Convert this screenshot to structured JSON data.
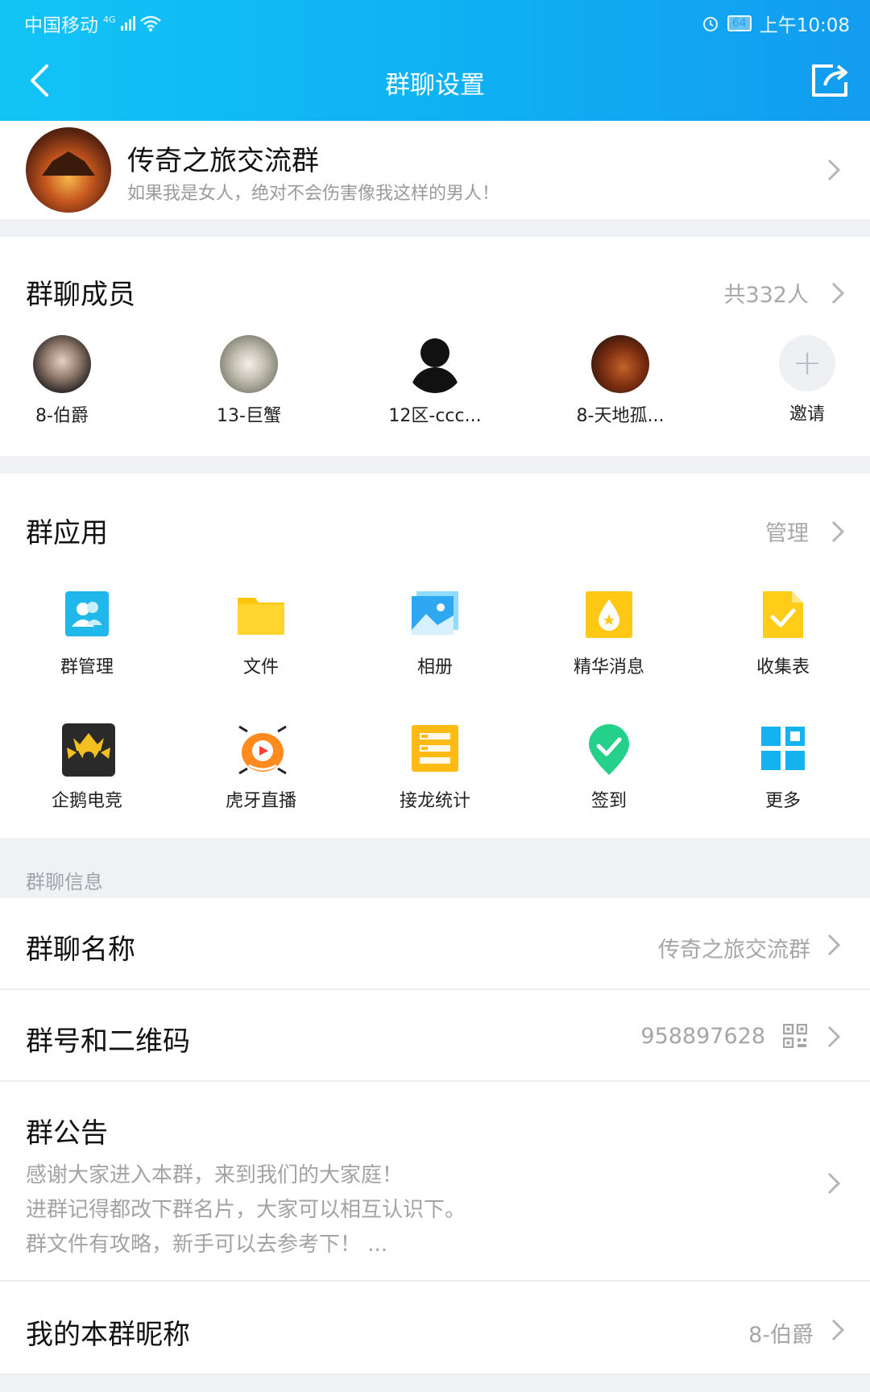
{
  "status_bar": {
    "carrier": "中国移动",
    "network": "4G",
    "battery": "64",
    "time": "上午10:08"
  },
  "nav": {
    "title": "群聊设置"
  },
  "group": {
    "name": "传奇之旅交流群",
    "description": "如果我是女人，绝对不会伤害像我这样的男人！"
  },
  "members": {
    "title": "群聊成员",
    "count": "共332人",
    "items": [
      {
        "name": "8-伯爵"
      },
      {
        "name": "13-巨蟹"
      },
      {
        "name": "12区-ccc..."
      },
      {
        "name": "8-天地孤..."
      }
    ],
    "invite_label": "邀请"
  },
  "apps": {
    "title": "群应用",
    "manage_label": "管理",
    "items": [
      {
        "label": "群管理",
        "icon": "group-manage-icon"
      },
      {
        "label": "文件",
        "icon": "folder-icon"
      },
      {
        "label": "相册",
        "icon": "album-icon"
      },
      {
        "label": "精华消息",
        "icon": "essence-icon"
      },
      {
        "label": "收集表",
        "icon": "form-icon"
      },
      {
        "label": "企鹅电竞",
        "icon": "penguin-esports-icon"
      },
      {
        "label": "虎牙直播",
        "icon": "huya-live-icon"
      },
      {
        "label": "接龙统计",
        "icon": "relay-stats-icon"
      },
      {
        "label": "签到",
        "icon": "checkin-icon"
      },
      {
        "label": "更多",
        "icon": "more-grid-icon"
      }
    ]
  },
  "info": {
    "section_title": "群聊信息",
    "name_label": "群聊名称",
    "name_value": "传奇之旅交流群",
    "number_label": "群号和二维码",
    "number_value": "958897628",
    "notice_label": "群公告",
    "notice_lines": [
      "感谢大家进入本群，来到我们的大家庭！",
      "进群记得都改下群名片，大家可以相互认识下。",
      "群文件有攻略，新手可以去参考下！ ..."
    ],
    "nickname_label": "我的本群昵称",
    "nickname_value": "8-伯爵"
  },
  "colors": {
    "header_start": "#12c4f6",
    "header_end": "#139cf0",
    "accent_blue": "#12b7f5"
  }
}
